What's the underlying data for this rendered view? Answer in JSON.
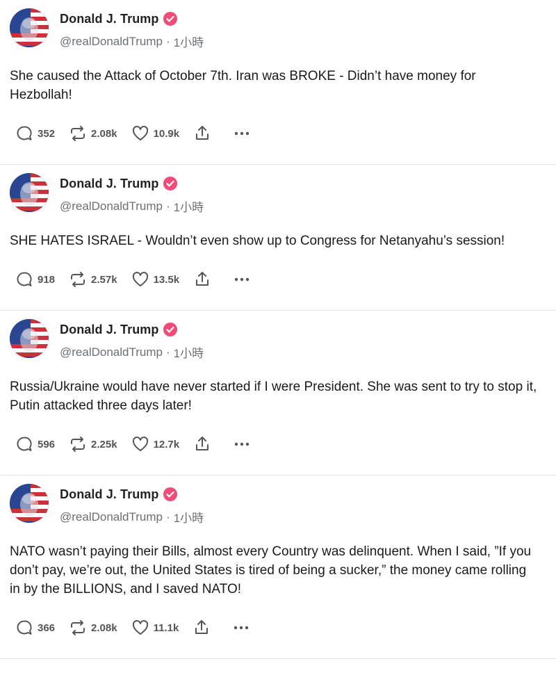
{
  "posts": [
    {
      "author": "Donald J. Trump",
      "handle": "@realDonaldTrump",
      "time": "1小時",
      "text": "She caused the Attack of October 7th. Iran was BROKE - Didn’t have money for Hezbollah!",
      "replies": "352",
      "reposts": "2.08k",
      "likes": "10.9k"
    },
    {
      "author": "Donald J. Trump",
      "handle": "@realDonaldTrump",
      "time": "1小時",
      "text": "SHE HATES ISRAEL - Wouldn’t even show up to Congress for Netanyahu’s session!",
      "replies": "918",
      "reposts": "2.57k",
      "likes": "13.5k"
    },
    {
      "author": "Donald J. Trump",
      "handle": "@realDonaldTrump",
      "time": "1小時",
      "text": "Russia/Ukraine would have never started if I were President. She was sent to try to stop it, Putin attacked three days later!",
      "replies": "596",
      "reposts": "2.25k",
      "likes": "12.7k"
    },
    {
      "author": "Donald J. Trump",
      "handle": "@realDonaldTrump",
      "time": "1小時",
      "text": "NATO wasn’t paying their Bills, almost every Country was delinquent. When I said, ”If you don’t pay, we’re out, the United States is tired of being a sucker,” the money came rolling in by the BILLIONS, and I saved NATO!",
      "replies": "366",
      "reposts": "2.08k",
      "likes": "11.1k"
    }
  ],
  "icons": {
    "verified": "verified-badge-icon",
    "reply": "reply-bubble-icon",
    "repost": "repost-arrows-icon",
    "like": "heart-icon",
    "share": "share-upload-icon",
    "more": "more-dots-icon"
  },
  "colors": {
    "verified": "#ef4c7a",
    "text": "#1a1a1a",
    "muted": "#6b6f73",
    "divider": "#e6e6e6"
  }
}
